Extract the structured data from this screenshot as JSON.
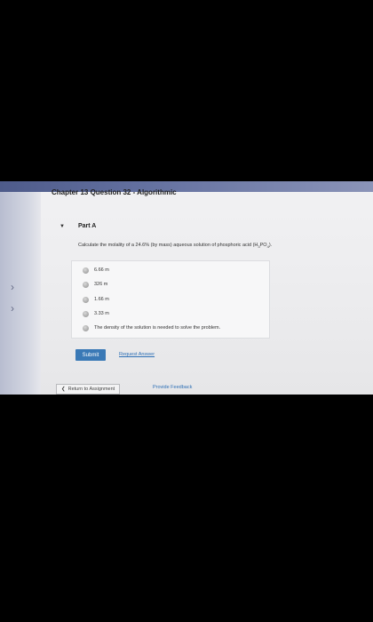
{
  "header": {
    "title": "Chapter 13 Question 32 - Algorithmic"
  },
  "part": {
    "toggle_icon": "▼",
    "label": "Part A"
  },
  "question": {
    "text_before": "Calculate the molality of a 24.6% (by mass) aqueous solution of phosphoric acid (H",
    "sub1": "3",
    "text_mid": "PO",
    "sub2": "4",
    "text_after": ")."
  },
  "options": [
    {
      "label": "6.66 m"
    },
    {
      "label": "326 m"
    },
    {
      "label": "1.66 m"
    },
    {
      "label": "3.33 m"
    },
    {
      "label": "The density of the solution is needed to solve the problem."
    }
  ],
  "actions": {
    "submit_label": "Submit",
    "request_answer_label": "Request Answer"
  },
  "footer": {
    "return_icon": "❮",
    "return_label": "Return to Assignment",
    "feedback_label": "Provide Feedback"
  },
  "side_nav": {
    "chevron_icon": "›"
  }
}
